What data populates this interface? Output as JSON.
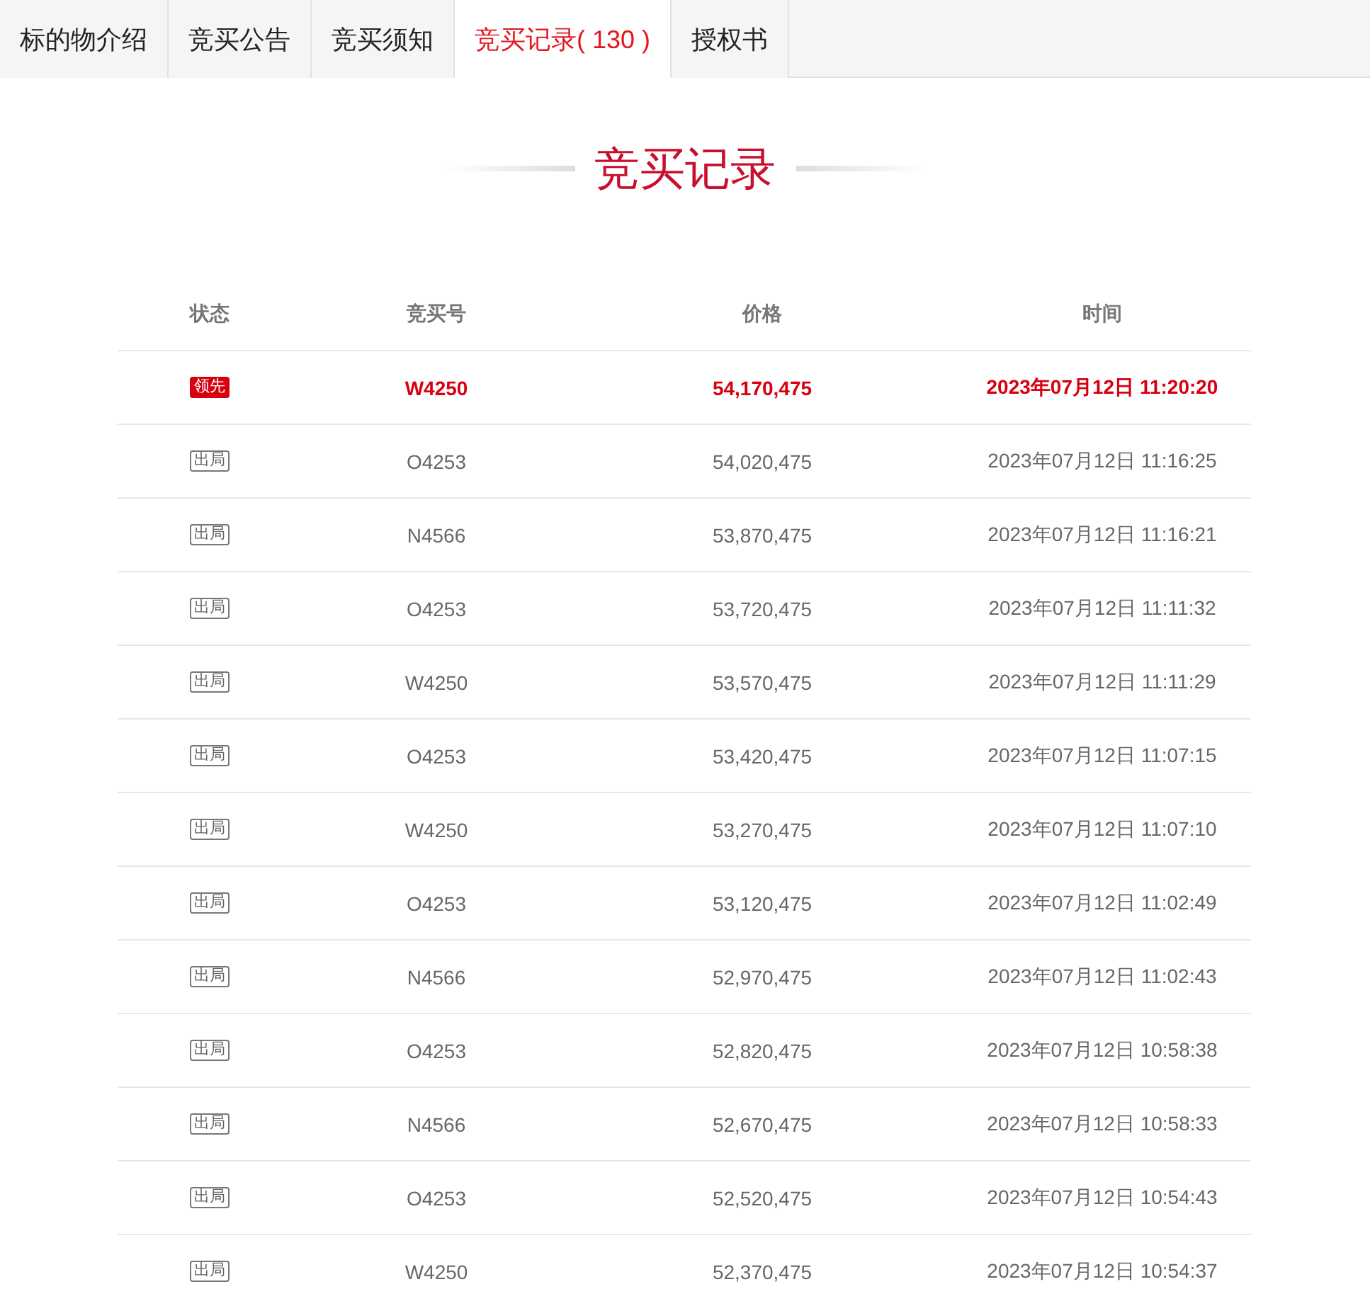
{
  "tabs": [
    {
      "label": "标的物介绍",
      "selected": false
    },
    {
      "label": "竞买公告",
      "selected": false
    },
    {
      "label": "竞买须知",
      "selected": false
    },
    {
      "label": "竞买记录",
      "count": "( 130 )",
      "selected": true
    },
    {
      "label": "授权书",
      "selected": false
    }
  ],
  "section_title": "竞买记录",
  "table": {
    "columns": [
      "状态",
      "竞买号",
      "价格",
      "时间"
    ],
    "rows": [
      {
        "kind": "lead",
        "status": "领先",
        "bidder": "W4250",
        "price": "54,170,475",
        "time": "2023年07月12日 11:20:20"
      },
      {
        "kind": "out",
        "status": "出局",
        "bidder": "O4253",
        "price": "54,020,475",
        "time": "2023年07月12日 11:16:25"
      },
      {
        "kind": "out",
        "status": "出局",
        "bidder": "N4566",
        "price": "53,870,475",
        "time": "2023年07月12日 11:16:21"
      },
      {
        "kind": "out",
        "status": "出局",
        "bidder": "O4253",
        "price": "53,720,475",
        "time": "2023年07月12日 11:11:32"
      },
      {
        "kind": "out",
        "status": "出局",
        "bidder": "W4250",
        "price": "53,570,475",
        "time": "2023年07月12日 11:11:29"
      },
      {
        "kind": "out",
        "status": "出局",
        "bidder": "O4253",
        "price": "53,420,475",
        "time": "2023年07月12日 11:07:15"
      },
      {
        "kind": "out",
        "status": "出局",
        "bidder": "W4250",
        "price": "53,270,475",
        "time": "2023年07月12日 11:07:10"
      },
      {
        "kind": "out",
        "status": "出局",
        "bidder": "O4253",
        "price": "53,120,475",
        "time": "2023年07月12日 11:02:49"
      },
      {
        "kind": "out",
        "status": "出局",
        "bidder": "N4566",
        "price": "52,970,475",
        "time": "2023年07月12日 11:02:43"
      },
      {
        "kind": "out",
        "status": "出局",
        "bidder": "O4253",
        "price": "52,820,475",
        "time": "2023年07月12日 10:58:38"
      },
      {
        "kind": "out",
        "status": "出局",
        "bidder": "N4566",
        "price": "52,670,475",
        "time": "2023年07月12日 10:58:33"
      },
      {
        "kind": "out",
        "status": "出局",
        "bidder": "O4253",
        "price": "52,520,475",
        "time": "2023年07月12日 10:54:43"
      },
      {
        "kind": "out",
        "status": "出局",
        "bidder": "W4250",
        "price": "52,370,475",
        "time": "2023年07月12日 10:54:37"
      }
    ]
  }
}
